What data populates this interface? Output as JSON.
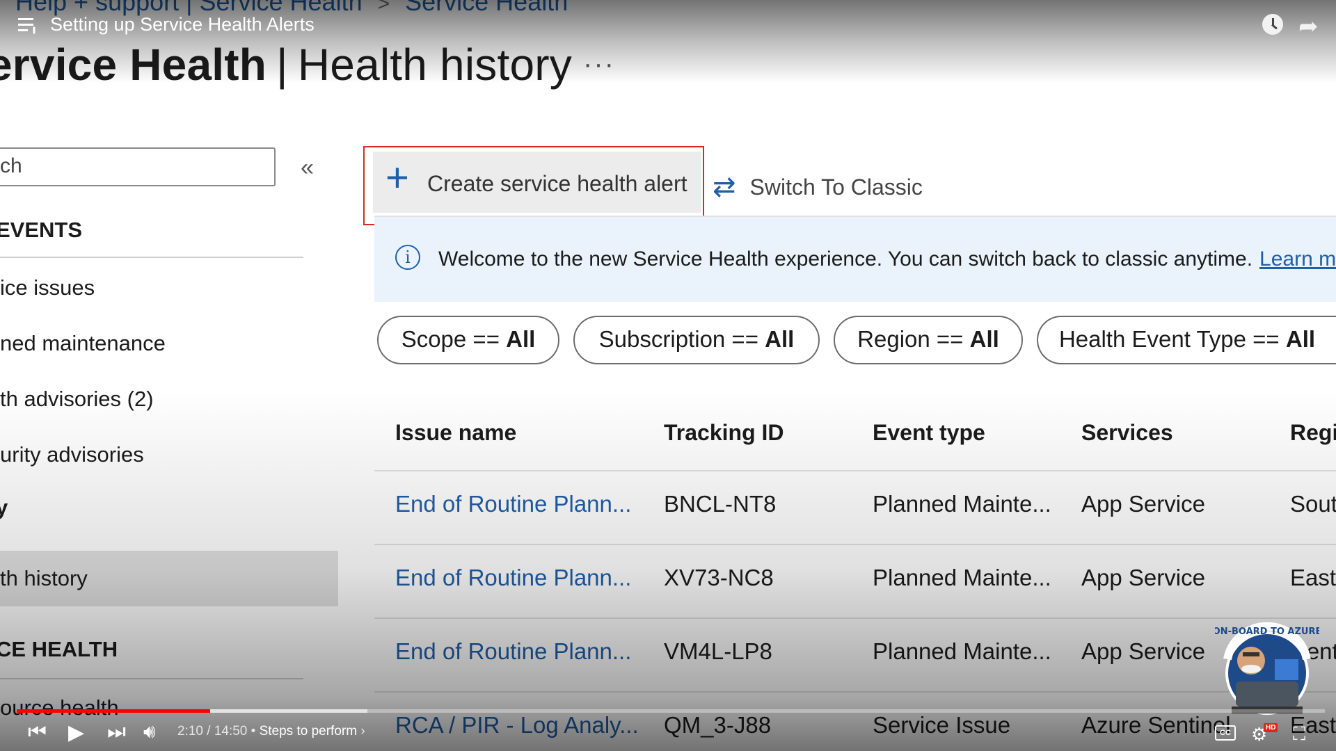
{
  "breadcrumb": [
    "Help + support | Service Health",
    "Service Health"
  ],
  "title": {
    "main": "ervice Health",
    "divider": "|",
    "sub": "Health history",
    "more": "···"
  },
  "sidebar": {
    "search_text": "ch",
    "collapse": "«",
    "events_heading": "EVENTS",
    "items": [
      "ice issues",
      "ned maintenance",
      "th advisories (2)",
      "urity advisories"
    ],
    "history_heading": "y",
    "selected_item": "th history",
    "resource_heading": "CE HEALTH",
    "resource_item": "ource health"
  },
  "toolbar": {
    "create_label": "Create service health alert",
    "switch_label": "Switch To Classic"
  },
  "banner": {
    "text": "Welcome to the new Service Health experience. You can switch back to classic anytime.",
    "link": "Learn more"
  },
  "filters": [
    {
      "key": "Scope ==",
      "value": "All"
    },
    {
      "key": "Subscription ==",
      "value": "All"
    },
    {
      "key": "Region ==",
      "value": "All"
    },
    {
      "key": "Health Event Type ==",
      "value": "All"
    }
  ],
  "table": {
    "headers": [
      "Issue name",
      "Tracking ID",
      "Event type",
      "Services",
      "Regions"
    ],
    "rows": [
      [
        "End of Routine Plann...",
        "BNCL-NT8",
        "Planned Mainte...",
        "App Service",
        "South"
      ],
      [
        "End of Routine Plann...",
        "XV73-NC8",
        "Planned Mainte...",
        "App Service",
        "East"
      ],
      [
        "End of Routine Plann...",
        "VM4L-LP8",
        "Planned Mainte...",
        "App Service",
        "Cent"
      ],
      [
        "RCA / PIR - Log Analy...",
        "QM_3-J88",
        "Service Issue",
        "Azure Sentinel",
        "East"
      ]
    ]
  },
  "video": {
    "title": "Setting up Service Health Alerts",
    "time": "2:10 / 14:50",
    "chapter": "Steps to perform",
    "progress": 0.148,
    "buffered": 0.268,
    "accent": "#ff0000"
  },
  "channel": {
    "name": "ON-BOARD TO AZURE"
  }
}
